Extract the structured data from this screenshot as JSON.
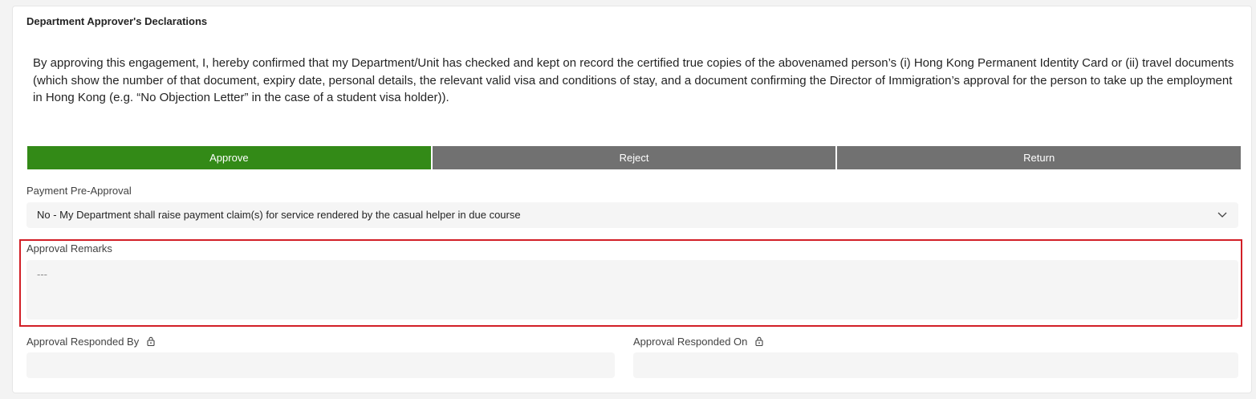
{
  "section": {
    "title": "Department Approver's Declarations",
    "declaration": "By approving this engagement, I, hereby confirmed that my Department/Unit has checked and kept on record the certified true copies of the abovenamed person’s (i) Hong Kong Permanent Identity Card or (ii) travel documents (which show the number of that document, expiry date, personal details, the relevant valid visa and conditions of stay, and a document confirming the Director of Immigration’s approval for the person to take up the employment in Hong Kong (e.g. “No Objection Letter” in the case of a student visa holder))."
  },
  "decision": {
    "options": [
      "Approve",
      "Reject",
      "Return"
    ],
    "selected": "Approve"
  },
  "payment_pre_approval": {
    "label": "Payment Pre-Approval",
    "value": "No - My Department shall raise payment claim(s) for service rendered by the casual helper in due course"
  },
  "approval_remarks": {
    "label": "Approval Remarks",
    "placeholder": "---"
  },
  "responded_by": {
    "label": "Approval Responded By",
    "value": ""
  },
  "responded_on": {
    "label": "Approval Responded On",
    "value": ""
  },
  "colors": {
    "selected": "#338a17",
    "unselected": "#717171",
    "highlight": "#d21f27"
  },
  "icons": [
    "chevron-down-icon",
    "lock-icon"
  ]
}
